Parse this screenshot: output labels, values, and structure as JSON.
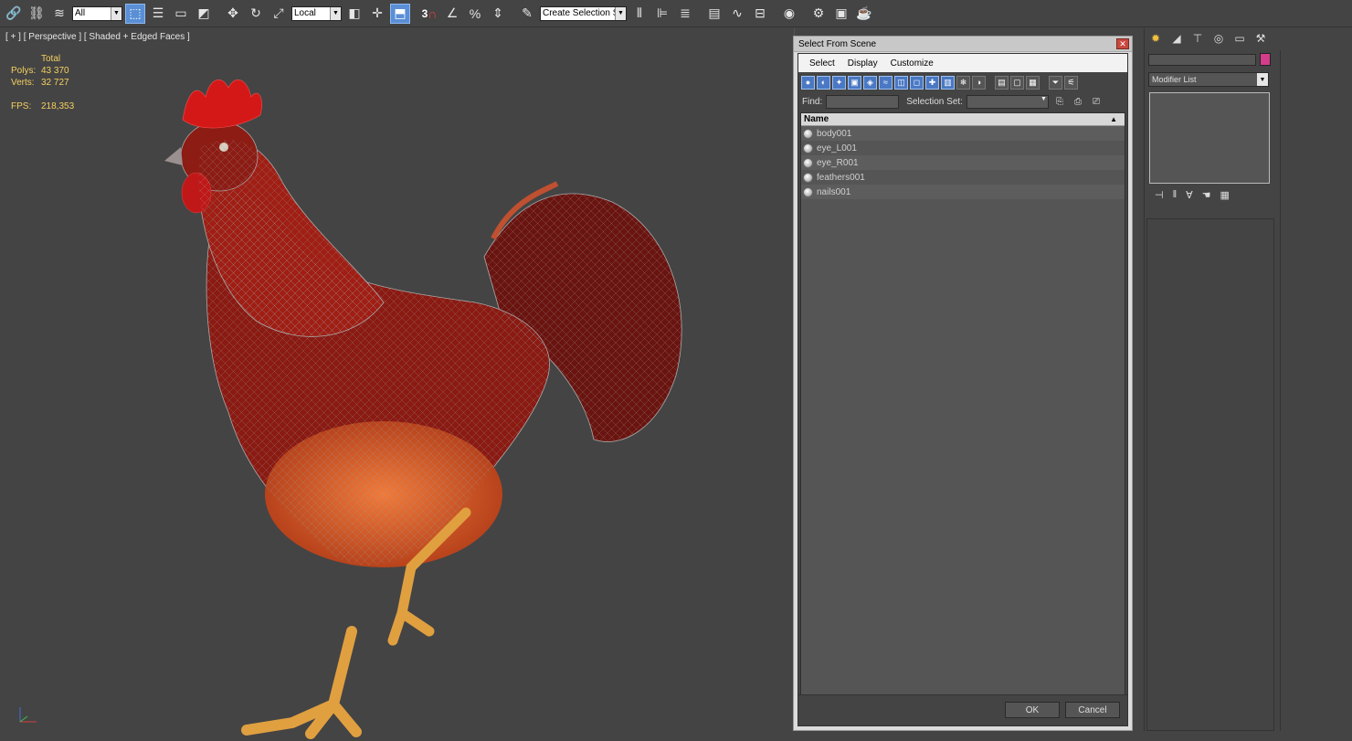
{
  "toolbar": {
    "filter_value": "All",
    "coord_value": "Local",
    "snap_3": "3",
    "named_sel": "Create Selection Se",
    "colors": {
      "active": "#5a8fd6"
    }
  },
  "viewport": {
    "label": "[ + ] [ Perspective ] [ Shaded + Edged Faces ]",
    "stats": {
      "header": "Total",
      "polys_label": "Polys:",
      "polys_value": "43 370",
      "verts_label": "Verts:",
      "verts_value": "32 727",
      "fps_label": "FPS:",
      "fps_value": "218,353"
    }
  },
  "dialog": {
    "title": "Select From Scene",
    "menu": [
      "Select",
      "Display",
      "Customize"
    ],
    "find_label": "Find:",
    "selset_label": "Selection Set:",
    "list_header": "Name",
    "items": [
      "body001",
      "eye_L001",
      "eye_R001",
      "feathers001",
      "nails001"
    ],
    "ok": "OK",
    "cancel": "Cancel"
  },
  "command_panel": {
    "modifier_list": "Modifier List",
    "object_color": "#d43d8a"
  }
}
